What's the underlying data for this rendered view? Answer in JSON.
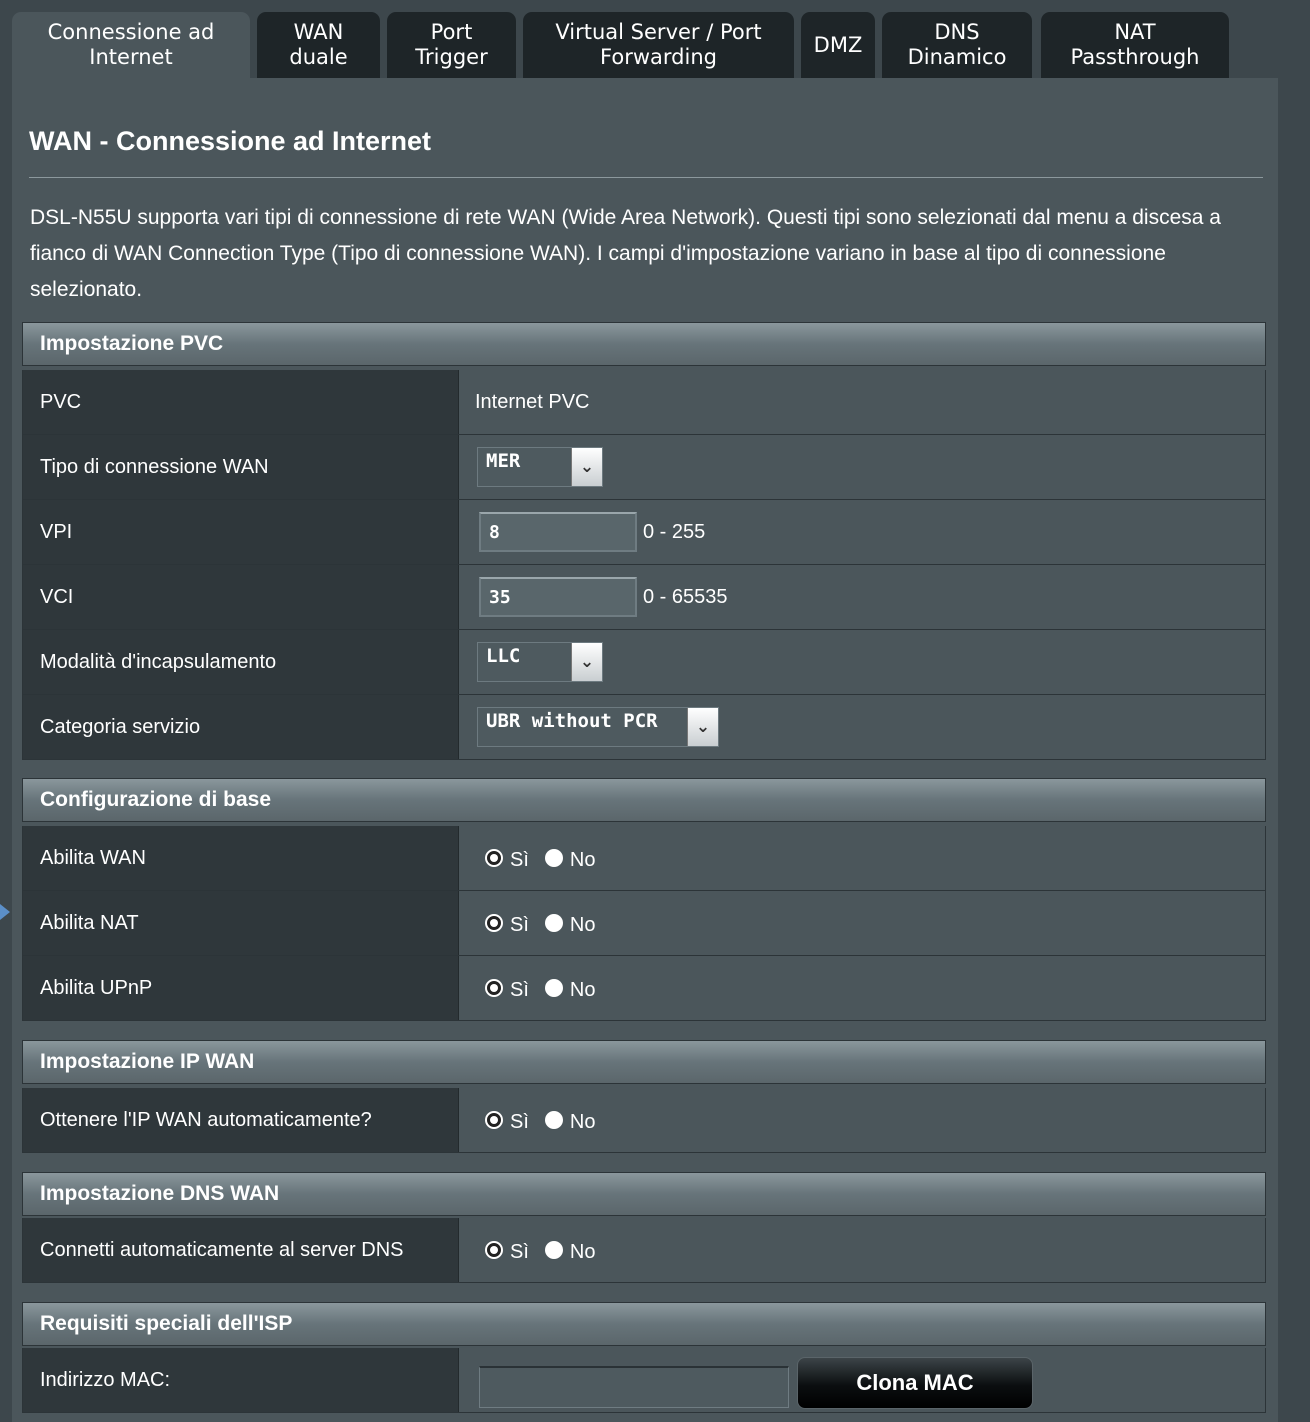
{
  "tabs": [
    {
      "label": "Connessione ad\nInternet",
      "active": true
    },
    {
      "label": "WAN\nduale"
    },
    {
      "label": "Port\nTrigger"
    },
    {
      "label": "Virtual Server / Port\nForwarding"
    },
    {
      "label": "DMZ"
    },
    {
      "label": "DNS\nDinamico"
    },
    {
      "label": "NAT\nPassthrough"
    }
  ],
  "page": {
    "title": "WAN - Connessione ad Internet",
    "description": "DSL-N55U supporta vari tipi di connessione di rete WAN (Wide Area Network). Questi tipi sono selezionati dal menu a discesa a fianco di WAN Connection Type (Tipo di connessione WAN). I campi d'impostazione variano in base al tipo di connessione selezionato."
  },
  "pvc": {
    "header": "Impostazione PVC",
    "pvc_label": "PVC",
    "pvc_value": "Internet PVC",
    "wan_type_label": "Tipo di connessione WAN",
    "wan_type_value": "MER",
    "vpi_label": "VPI",
    "vpi_value": "8",
    "vpi_range": "0 - 255",
    "vci_label": "VCI",
    "vci_value": "35",
    "vci_range": "0 - 65535",
    "encap_label": "Modalità d'incapsulamento",
    "encap_value": "LLC",
    "service_label": "Categoria servizio",
    "service_value": "UBR without PCR"
  },
  "basic": {
    "header": "Configurazione di base",
    "enable_wan_label": "Abilita WAN",
    "enable_nat_label": "Abilita NAT",
    "enable_upnp_label": "Abilita UPnP"
  },
  "radio": {
    "yes": "Sì",
    "no": "No"
  },
  "wan_ip": {
    "header": "Impostazione IP WAN",
    "auto_ip_label": "Ottenere l'IP WAN automaticamente?"
  },
  "wan_dns": {
    "header": "Impostazione DNS WAN",
    "auto_dns_label": "Connetti automaticamente al server DNS"
  },
  "isp": {
    "header": "Requisiti speciali dell'ISP",
    "mac_label": "Indirizzo MAC:",
    "mac_value": "",
    "clone_button": "Clona MAC"
  },
  "icons": {
    "dropdown": "chevron-down-icon",
    "side_marker": "triangle-right-icon"
  },
  "colors": {
    "background": "#3d474c",
    "panel": "#4b565b",
    "label_cell": "#2f373b",
    "tab": "#1e2528"
  }
}
